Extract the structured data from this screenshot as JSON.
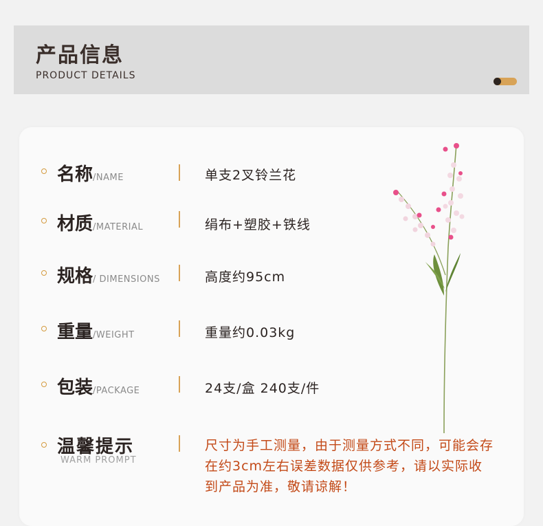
{
  "header": {
    "title": "产品信息",
    "subtitle": "PRODUCT DETAILS"
  },
  "details": [
    {
      "label": "名称",
      "en": "/NAME",
      "value": "单支2叉铃兰花"
    },
    {
      "label": "材质",
      "en": "/MATERIAL",
      "value": "绢布+塑胶+铁线"
    },
    {
      "label": "规格",
      "en": "/ DIMENSIONS",
      "value": "高度约95cm"
    },
    {
      "label": "重量",
      "en": "/WEIGHT",
      "value": "重量约0.03kg"
    },
    {
      "label": "包装",
      "en": "/PACKAGE",
      "value": "24支/盒 240支/件"
    }
  ],
  "prompt": {
    "label": "温馨提示",
    "en": "WARM PROMPT",
    "value": "尺寸为手工测量，由于测量方式不同，可能会存在约3cm左右误差数据仅供参考，请以实际收到产品为准，敬请谅解！"
  },
  "colors": {
    "accent": "#d8a357",
    "warning_text": "#c34a18",
    "flower_pink": "#e8508a",
    "stem_green": "#7a9a4a"
  }
}
